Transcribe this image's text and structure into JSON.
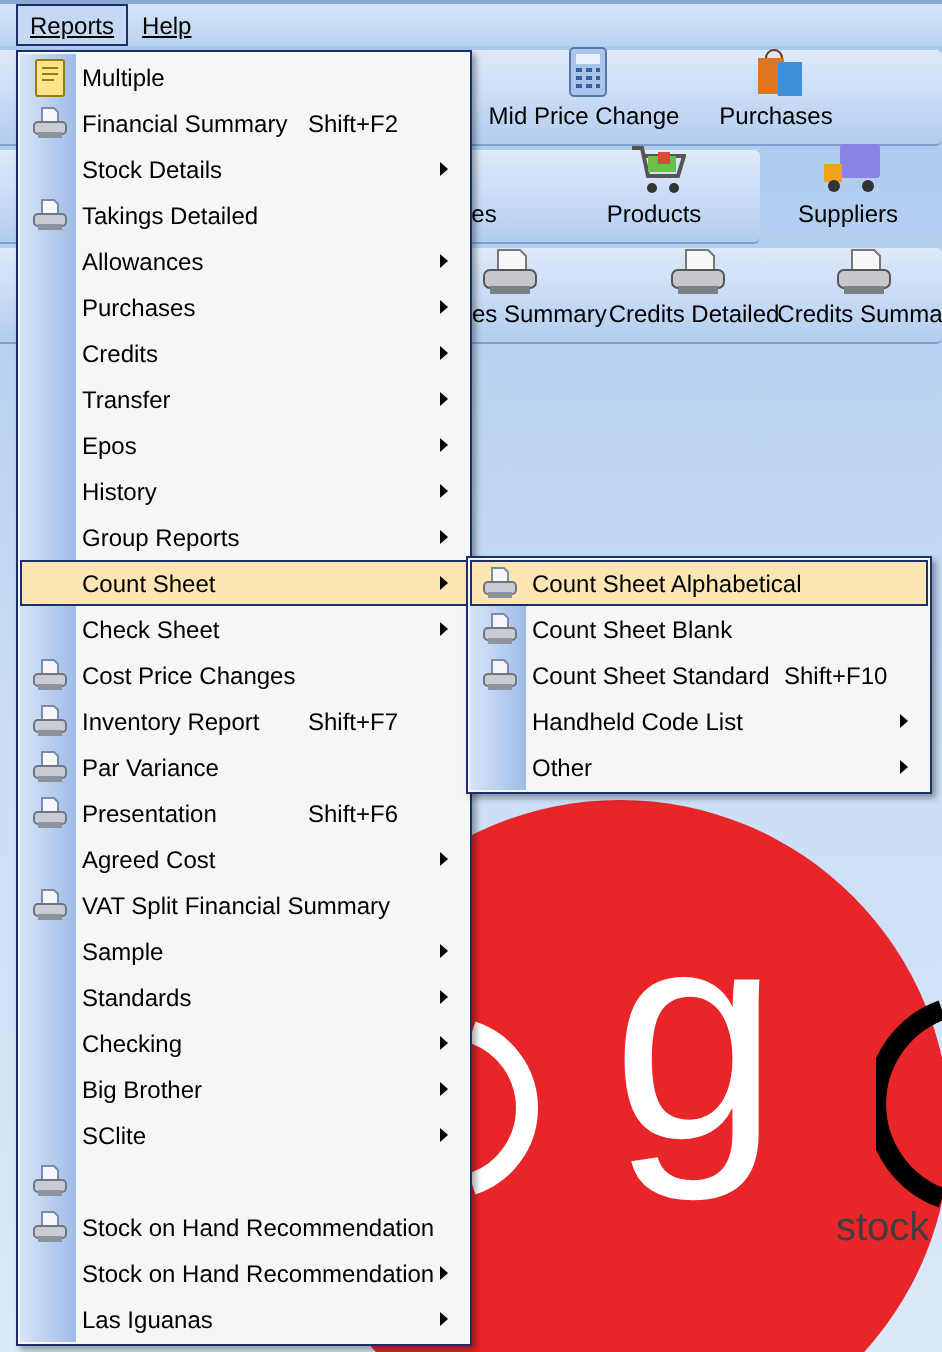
{
  "menu_bar": [
    {
      "label": "Reports",
      "selected": true
    },
    {
      "label": "Help",
      "selected": false
    }
  ],
  "toolbars": [
    {
      "buttons": [
        {
          "label": "Mid Price Change"
        },
        {
          "label": "Purchases"
        }
      ]
    },
    {
      "buttons": [
        {
          "label": "es"
        },
        {
          "label": "Products"
        },
        {
          "label": "Suppliers"
        }
      ]
    },
    {
      "buttons": [
        {
          "label": "es Summary"
        },
        {
          "label": "Credits Detailed"
        },
        {
          "label": "Credits Summa"
        }
      ]
    }
  ],
  "logo": {
    "letters": "g",
    "tagline": "stock"
  },
  "reports_menu": [
    {
      "label": "Multiple",
      "kind": "note",
      "submenu": false,
      "selected": false
    },
    {
      "label": "Financial Summary",
      "kind": "print",
      "shortcut": "Shift+F2",
      "submenu": false,
      "selected": false
    },
    {
      "label": "Stock Details",
      "kind": "plain",
      "submenu": true,
      "selected": false
    },
    {
      "label": "Takings Detailed",
      "kind": "print",
      "submenu": false,
      "selected": false
    },
    {
      "label": "Allowances",
      "kind": "plain",
      "submenu": true,
      "selected": false
    },
    {
      "label": "Purchases",
      "kind": "plain",
      "submenu": true,
      "selected": false
    },
    {
      "label": "Credits",
      "kind": "plain",
      "submenu": true,
      "selected": false
    },
    {
      "label": "Transfer",
      "kind": "plain",
      "submenu": true,
      "selected": false
    },
    {
      "label": "Epos",
      "kind": "plain",
      "submenu": true,
      "selected": false
    },
    {
      "label": "History",
      "kind": "plain",
      "submenu": true,
      "selected": false
    },
    {
      "label": "Group Reports",
      "kind": "plain",
      "submenu": true,
      "selected": false
    },
    {
      "label": "Count Sheet",
      "kind": "plain",
      "submenu": true,
      "selected": true
    },
    {
      "label": "Check Sheet",
      "kind": "plain",
      "submenu": true,
      "selected": false
    },
    {
      "label": "Cost Price Changes",
      "kind": "print",
      "submenu": false,
      "selected": false
    },
    {
      "label": "Inventory Report",
      "kind": "print",
      "shortcut": "Shift+F7",
      "submenu": false,
      "selected": false
    },
    {
      "label": "Par Variance",
      "kind": "print",
      "submenu": false,
      "selected": false
    },
    {
      "label": "Presentation",
      "kind": "print",
      "shortcut": "Shift+F6",
      "submenu": false,
      "selected": false
    },
    {
      "label": "Agreed Cost",
      "kind": "plain",
      "submenu": true,
      "selected": false
    },
    {
      "label": "VAT Split Financial Summary",
      "kind": "print",
      "submenu": false,
      "selected": false
    },
    {
      "label": "Sample",
      "kind": "plain",
      "submenu": true,
      "selected": false
    },
    {
      "label": "Standards",
      "kind": "plain",
      "submenu": true,
      "selected": false
    },
    {
      "label": "Checking",
      "kind": "plain",
      "submenu": true,
      "selected": false
    },
    {
      "label": "Big Brother",
      "kind": "plain",
      "submenu": true,
      "selected": false
    },
    {
      "label": "SClite",
      "kind": "plain",
      "submenu": true,
      "selected": false
    },
    {
      "kind": "print",
      "submenu": false,
      "selected": false
    },
    {
      "label": "Stock on Hand Recommendation",
      "kind": "print",
      "submenu": false,
      "selected": false
    },
    {
      "label": "Stock on Hand Recommendation",
      "kind": "plain",
      "submenu": true,
      "selected": false
    },
    {
      "label": "Las Iguanas",
      "kind": "plain",
      "submenu": true,
      "selected": false
    }
  ],
  "count_sheet_menu": [
    {
      "label": "Count Sheet Alphabetical",
      "kind": "print",
      "submenu": false,
      "selected": true
    },
    {
      "label": "Count Sheet Blank",
      "kind": "print",
      "submenu": false,
      "selected": false
    },
    {
      "label": "Count Sheet Standard",
      "kind": "print",
      "shortcut": "Shift+F10",
      "submenu": false,
      "selected": false
    },
    {
      "label": "Handheld Code List",
      "kind": "plain",
      "submenu": true,
      "selected": false
    },
    {
      "label": "Other",
      "kind": "plain",
      "submenu": true,
      "selected": false
    }
  ]
}
